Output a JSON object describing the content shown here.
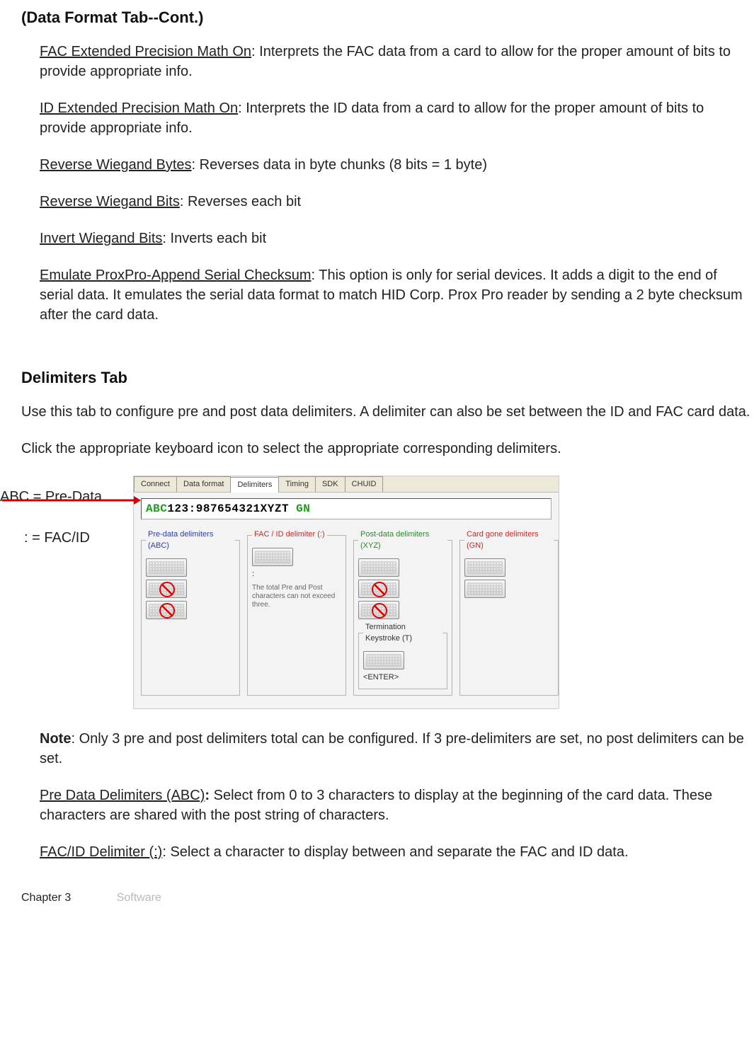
{
  "headings": {
    "data_format_cont": "(Data Format Tab--Cont.)",
    "delimiters_tab": "Delimiters Tab"
  },
  "definitions": {
    "fac_ext": {
      "term": "FAC Extended Precision Math On",
      "text": ": Interprets the FAC data from a card to allow for the proper amount of bits to provide appropriate info."
    },
    "id_ext": {
      "term": "ID Extended Precision Math On",
      "text": ": Interprets the ID data from a card to allow for the proper amount of bits to provide appropriate info."
    },
    "rev_bytes": {
      "term": "Reverse Wiegand Bytes",
      "text": ": Reverses data in byte chunks (8 bits = 1 byte)"
    },
    "rev_bits": {
      "term": "Reverse Wiegand Bits",
      "text": ": Reverses each bit"
    },
    "inv_bits": {
      "term": "Invert Wiegand Bits",
      "text": ": Inverts each bit"
    },
    "emulate": {
      "term": "Emulate ProxPro-Append Serial Checksum",
      "text": ": This option is only for serial devices. It adds a digit to the end of serial data. It emulates the serial data format to match HID Corp. Prox Pro reader by sending a 2 byte checksum after the card data."
    }
  },
  "delimiters_intro": {
    "p1": "Use this tab to configure pre and post data delimiters. A delimiter can also be set between the ID and FAC card data.",
    "p2": "Click the appropriate keyboard icon to select the appropriate corresponding delimiters."
  },
  "callout_labels": {
    "abc": "ABC = Pre-Data",
    "colon": ": = FAC/ID"
  },
  "screenshot": {
    "tabs": [
      "Connect",
      "Data format",
      "Delimiters",
      "Timing",
      "SDK",
      "CHUID"
    ],
    "active_tab_index": 2,
    "display_segments": {
      "abc": "ABC",
      "fac": "123",
      "colon": ":",
      "id": "987654321",
      "xyz": "XYZ",
      "t": "T",
      "gn": "  GN"
    },
    "groups": {
      "pre": "Pre-data delimiters (ABC)",
      "facid": "FAC / ID delimiter (:)",
      "facid_value": ":",
      "facid_note": "The total Pre and Post characters can not exceed three.",
      "post": "Post-data delimiters (XYZ)",
      "term": "Termination Keystroke (T)",
      "term_value": "<ENTER>",
      "gone": "Card gone delimiters (GN)"
    }
  },
  "note": {
    "label": "Note",
    "text": ": Only 3 pre and post delimiters total can be configured. If 3 pre-delimiters are set, no post delimiters can be set."
  },
  "post_defs": {
    "pre_data": {
      "term": "Pre Data Delimiters (ABC)",
      "bold_colon": ":",
      "text": " Select from 0 to 3 characters to display at the beginning of the card data. These characters are shared with the post string of characters."
    },
    "facid": {
      "term": "FAC/ID Delimiter (:)",
      "text": ": Select a character to display between and separate the FAC and ID data."
    }
  },
  "footer": {
    "chapter": "Chapter 3",
    "section": "Software"
  }
}
